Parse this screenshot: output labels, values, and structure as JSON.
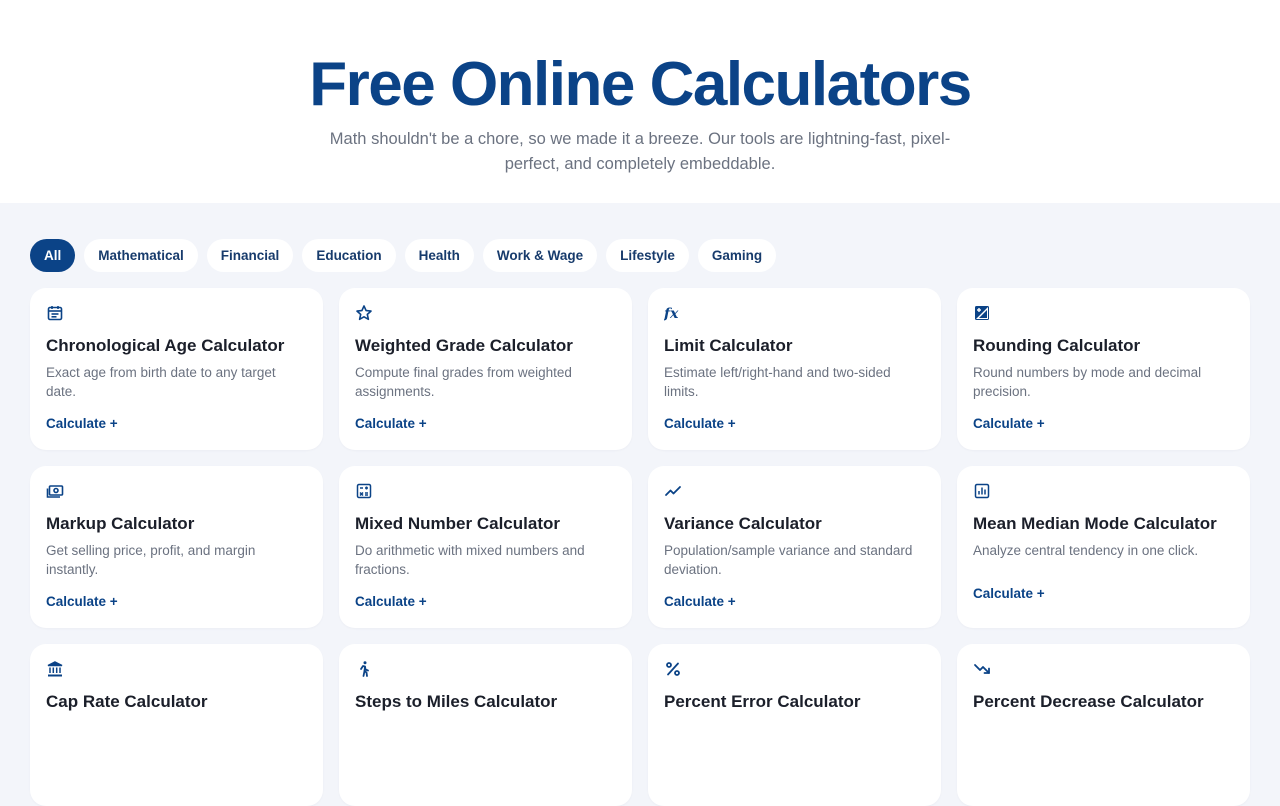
{
  "hero": {
    "title": "Free Online Calculators",
    "subtitle": "Math shouldn't be a chore, so we made it a breeze. Our tools are lightning-fast, pixel-perfect, and completely embeddable."
  },
  "filters": [
    {
      "label": "All",
      "active": true
    },
    {
      "label": "Mathematical",
      "active": false
    },
    {
      "label": "Financial",
      "active": false
    },
    {
      "label": "Education",
      "active": false
    },
    {
      "label": "Health",
      "active": false
    },
    {
      "label": "Work & Wage",
      "active": false
    },
    {
      "label": "Lifestyle",
      "active": false
    },
    {
      "label": "Gaming",
      "active": false
    }
  ],
  "cards": [
    {
      "icon": "calendar-icon",
      "title": "Chronological Age Calculator",
      "desc": "Exact age from birth date to any target date.",
      "cta": "Calculate +"
    },
    {
      "icon": "star-icon",
      "title": "Weighted Grade Calculator",
      "desc": "Compute final grades from weighted assignments.",
      "cta": "Calculate +"
    },
    {
      "icon": "function-icon",
      "title": "Limit Calculator",
      "desc": "Estimate left/right-hand and two-sided limits.",
      "cta": "Calculate +"
    },
    {
      "icon": "rounding-icon",
      "title": "Rounding Calculator",
      "desc": "Round numbers by mode and decimal precision.",
      "cta": "Calculate +"
    },
    {
      "icon": "money-icon",
      "title": "Markup Calculator",
      "desc": "Get selling price, profit, and margin instantly.",
      "cta": "Calculate +"
    },
    {
      "icon": "calculator-icon",
      "title": "Mixed Number Calculator",
      "desc": "Do arithmetic with mixed numbers and fractions.",
      "cta": "Calculate +"
    },
    {
      "icon": "trend-up-icon",
      "title": "Variance Calculator",
      "desc": "Population/sample variance and standard deviation.",
      "cta": "Calculate +"
    },
    {
      "icon": "bar-chart-icon",
      "title": "Mean Median Mode Calculator",
      "desc": "Analyze central tendency in one click.",
      "cta": "Calculate +"
    },
    {
      "icon": "bank-icon",
      "title": "Cap Rate Calculator",
      "desc": "",
      "cta": ""
    },
    {
      "icon": "walking-icon",
      "title": "Steps to Miles Calculator",
      "desc": "",
      "cta": ""
    },
    {
      "icon": "percent-icon",
      "title": "Percent Error Calculator",
      "desc": "",
      "cta": ""
    },
    {
      "icon": "trend-down-icon",
      "title": "Percent Decrease Calculator",
      "desc": "",
      "cta": ""
    }
  ],
  "colors": {
    "brand": "#0b4387",
    "background": "#f3f5fa",
    "card": "#ffffff",
    "muted_text": "#6b7280"
  }
}
